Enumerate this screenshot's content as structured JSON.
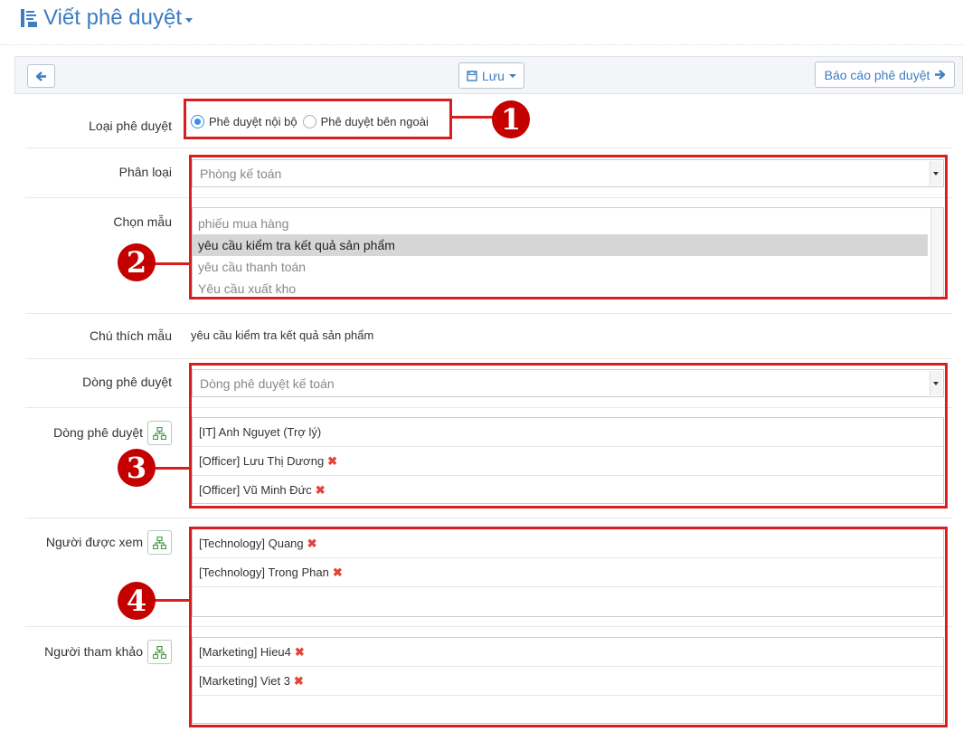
{
  "header": {
    "title": "Viết phê duyệt"
  },
  "toolbar": {
    "save_label": "Lưu",
    "report_label": "Báo cáo phê duyệt"
  },
  "form": {
    "approval_type": {
      "label": "Loại phê duyệt",
      "options": [
        "Phê duyệt nội bộ",
        "Phê duyệt bên ngoài"
      ],
      "selected": "Phê duyệt nội bộ"
    },
    "category": {
      "label": "Phân loại",
      "value": "Phòng kế toán"
    },
    "template": {
      "label": "Chọn mẫu",
      "options": [
        "phiếu mua hàng",
        "yêu cầu kiểm tra kết quả sản phẩm",
        "yêu cầu thanh toán",
        "Yêu cầu xuất kho"
      ],
      "selected": "yêu cầu kiểm tra kết quả sản phẩm"
    },
    "template_note": {
      "label": "Chú thích mẫu",
      "value": "yêu cầu kiểm tra kết quả sản phẩm"
    },
    "approval_flow": {
      "label": "Dòng phê duyệt",
      "value": "Dòng phê duyệt kế toán"
    },
    "approvers": {
      "label": "Dòng phê duyệt",
      "items": [
        "[IT] Anh Nguyet (Trợ lý)",
        "[Officer] Lưu Thị Dương",
        "[Officer] Vũ Minh Đức"
      ]
    },
    "viewers": {
      "label": "Người được xem",
      "items": [
        "[Technology] Quang",
        "[Technology] Trong Phan"
      ]
    },
    "references": {
      "label": "Người tham khảo",
      "items": [
        "[Marketing] Hieu4",
        "[Marketing] Viet 3"
      ]
    }
  },
  "annotations": [
    "1",
    "2",
    "3",
    "4"
  ],
  "colors": {
    "accent": "#3d7dc2",
    "annotation": "#d81f1f",
    "remove": "#e0453a"
  },
  "icons": [
    "document-icon",
    "arrow-left-icon",
    "save-icon",
    "arrow-right-icon",
    "org-chart-icon",
    "remove-icon"
  ]
}
